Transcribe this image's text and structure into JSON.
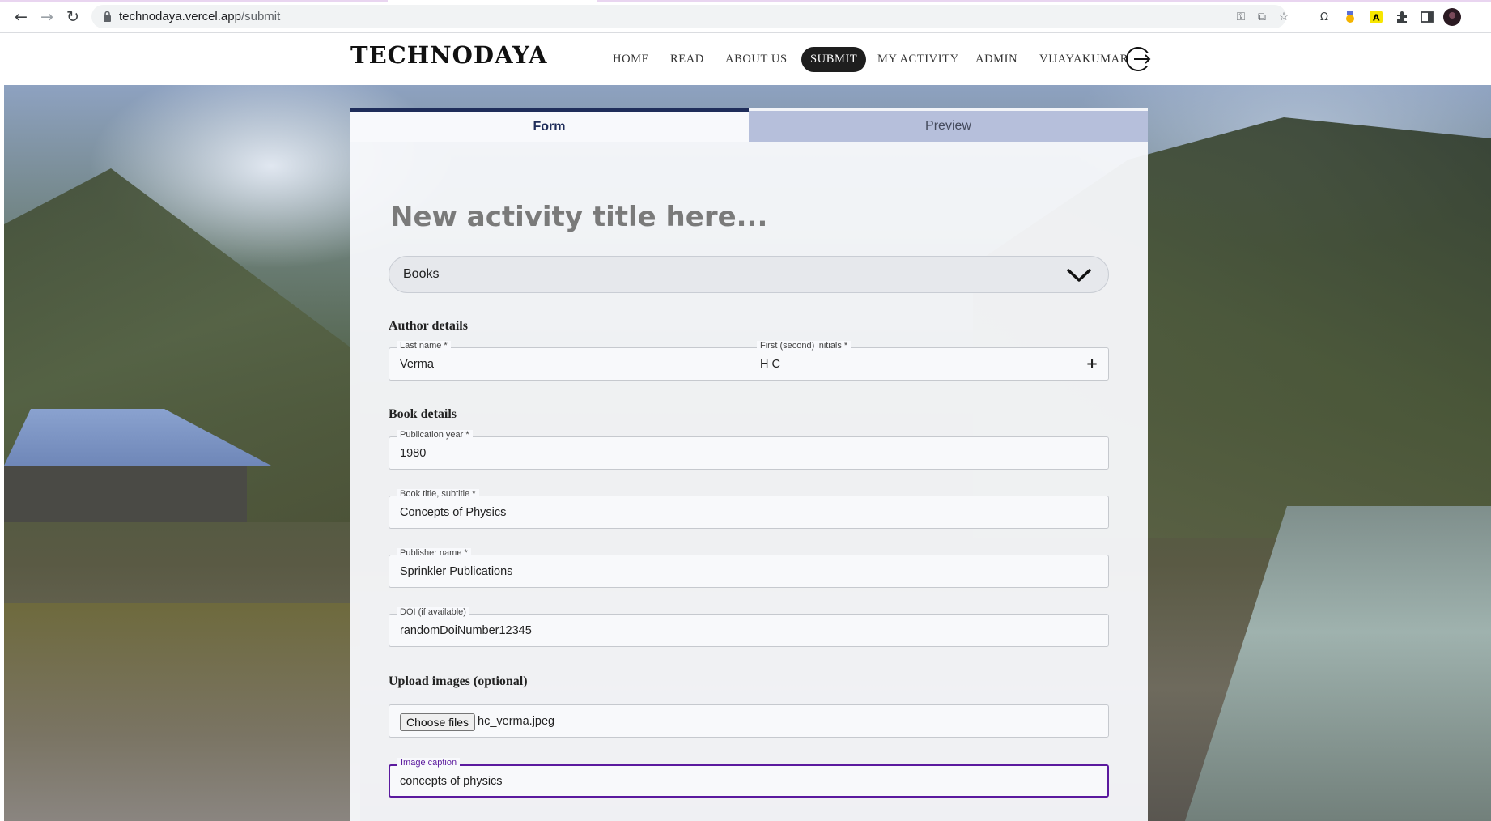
{
  "browser": {
    "url_domain": "technodaya.vercel.app",
    "url_path": "/submit"
  },
  "site": {
    "logo": "TECHNODAYA",
    "nav": {
      "home": "HOME",
      "read": "READ",
      "about": "ABOUT US",
      "submit": "SUBMIT",
      "my_activity": "MY ACTIVITY",
      "admin": "ADMIN",
      "user": "VIJAYAKUMAR"
    }
  },
  "tabs": {
    "form": "Form",
    "preview": "Preview"
  },
  "form": {
    "title_placeholder": "New activity title here...",
    "category": "Books",
    "author_heading": "Author details",
    "last_name_label": "Last name *",
    "last_name_value": "Verma",
    "initials_label": "First (second) initials *",
    "initials_value": "H C",
    "book_heading": "Book details",
    "pub_year_label": "Publication year *",
    "pub_year_value": "1980",
    "book_title_label": "Book title, subtitle *",
    "book_title_value": "Concepts of Physics",
    "publisher_label": "Publisher name *",
    "publisher_value": "Sprinkler Publications",
    "doi_label": "DOI (if available)",
    "doi_value": "randomDoiNumber12345",
    "upload_heading": "Upload images (optional)",
    "choose_files_label": "Choose files",
    "file_name": "hc_verma.jpeg",
    "caption_label": "Image caption",
    "caption_value": "concepts of physics"
  },
  "colors": {
    "accent_purple": "#5b1a9e",
    "tab_navy": "#1f2d5a"
  }
}
